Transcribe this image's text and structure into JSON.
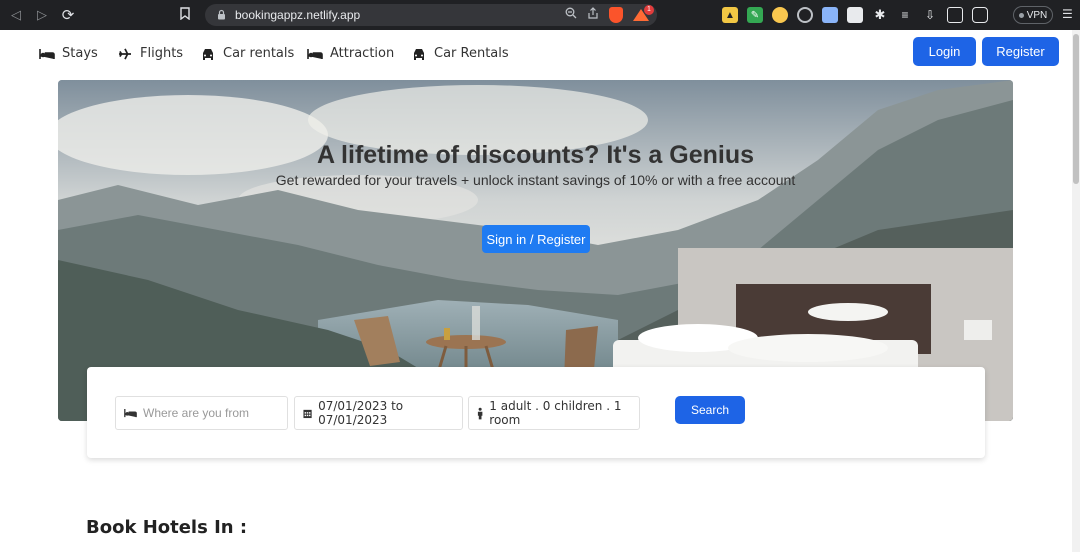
{
  "browser": {
    "url": "bookingappz.netlify.app",
    "rewards_badge": "1",
    "vpn_label": "VPN"
  },
  "nav": {
    "items": [
      {
        "label": "Stays",
        "icon": "bed-icon"
      },
      {
        "label": "Flights",
        "icon": "plane-icon"
      },
      {
        "label": "Car rentals",
        "icon": "car-icon"
      },
      {
        "label": "Attraction",
        "icon": "bed-icon"
      },
      {
        "label": "Car Rentals",
        "icon": "car-icon"
      }
    ],
    "login_label": "Login",
    "register_label": "Register"
  },
  "hero": {
    "title": "A lifetime of discounts? It's a Genius",
    "subtitle": "Get rewarded for your travels + unlock instant savings of 10% or with a free account",
    "cta_label": "Sign in / Register"
  },
  "search": {
    "destination_placeholder": "Where are you from",
    "date_range": "07/01/2023 to 07/01/2023",
    "guests": "1 adult . 0 children . 1 room",
    "search_label": "Search"
  },
  "section": {
    "heading": "Book Hotels In :"
  },
  "colors": {
    "primary": "#1e64e6",
    "cta": "#1f7bf2"
  }
}
